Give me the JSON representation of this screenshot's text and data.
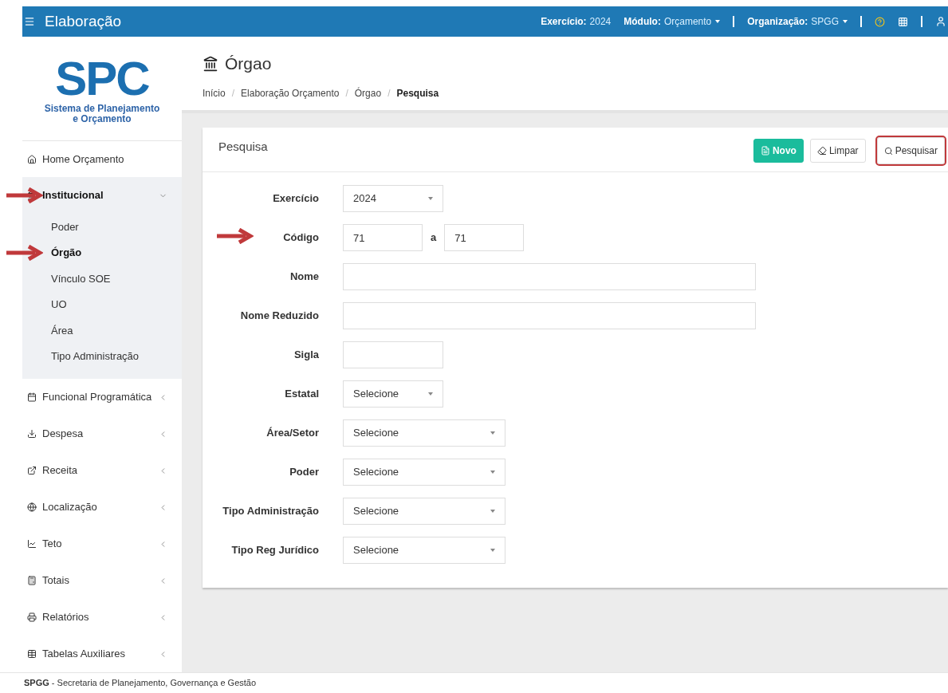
{
  "topbar": {
    "title": "Elaboração",
    "context": [
      {
        "label": "Exercício:",
        "value": "2024",
        "dropdown": false
      },
      {
        "label": "Módulo:",
        "value": "Orçamento",
        "dropdown": true
      },
      {
        "label": "Organização:",
        "value": "SPGG",
        "dropdown": true
      }
    ]
  },
  "logo": {
    "letters": "SPC",
    "subtitle": "Sistema de Planejamento e Orçamento"
  },
  "sidebar": {
    "items": [
      {
        "label": "Home Orçamento",
        "expanded": false,
        "annotated": false
      },
      {
        "label": "Institucional",
        "expanded": true,
        "annotated": true,
        "children": [
          {
            "label": "Poder",
            "selected": false,
            "annotated": false
          },
          {
            "label": "Órgão",
            "selected": true,
            "annotated": true
          },
          {
            "label": "Vínculo SOE",
            "selected": false,
            "annotated": false
          },
          {
            "label": "UO",
            "selected": false,
            "annotated": false
          },
          {
            "label": "Área",
            "selected": false,
            "annotated": false
          },
          {
            "label": "Tipo Administração",
            "selected": false,
            "annotated": false
          }
        ]
      },
      {
        "label": "Funcional Programática",
        "expanded": false,
        "annotated": false
      },
      {
        "label": "Despesa",
        "expanded": false,
        "annotated": false
      },
      {
        "label": "Receita",
        "expanded": false,
        "annotated": false
      },
      {
        "label": "Localização",
        "expanded": false,
        "annotated": false
      },
      {
        "label": "Teto",
        "expanded": false,
        "annotated": false
      },
      {
        "label": "Totais",
        "expanded": false,
        "annotated": false
      },
      {
        "label": "Relatórios",
        "expanded": false,
        "annotated": false
      },
      {
        "label": "Tabelas Auxiliares",
        "expanded": false,
        "annotated": false
      }
    ]
  },
  "page": {
    "title": "Órgao",
    "breadcrumb": [
      "Início",
      "Elaboração Orçamento",
      "Órgao",
      "Pesquisa"
    ],
    "separator": "/"
  },
  "card": {
    "title": "Pesquisa",
    "buttons": [
      {
        "label": "Novo",
        "kind": "primary",
        "highlighted": false
      },
      {
        "label": "Limpar",
        "kind": "eraser",
        "highlighted": false
      },
      {
        "label": "Pesquisar",
        "kind": "search",
        "highlighted": true
      }
    ],
    "fields": [
      {
        "label": "Exercício",
        "kind": "select",
        "value": "2024",
        "annotated": false
      },
      {
        "label": "Código",
        "kind": "range",
        "from": "71",
        "separator": "a",
        "to": "71",
        "annotated": true
      },
      {
        "label": "Nome",
        "kind": "widetext",
        "annotated": false
      },
      {
        "label": "Nome Reduzido",
        "kind": "widetext",
        "annotated": false
      },
      {
        "label": "Sigla",
        "kind": "text",
        "annotated": false
      },
      {
        "label": "Estatal",
        "kind": "select",
        "value": "Selecione",
        "annotated": false
      },
      {
        "label": "Área/Setor",
        "kind": "wideselect",
        "value": "Selecione",
        "annotated": false
      },
      {
        "label": "Poder",
        "kind": "wideselect",
        "value": "Selecione",
        "annotated": false
      },
      {
        "label": "Tipo Administração",
        "kind": "wideselect",
        "value": "Selecione",
        "annotated": false
      },
      {
        "label": "Tipo Reg Jurídico",
        "kind": "wideselect",
        "value": "Selecione",
        "annotated": false
      }
    ]
  },
  "footer": {
    "org": "SPGG",
    "text": "- Secretaria de Planejamento, Governança e Gestão"
  }
}
